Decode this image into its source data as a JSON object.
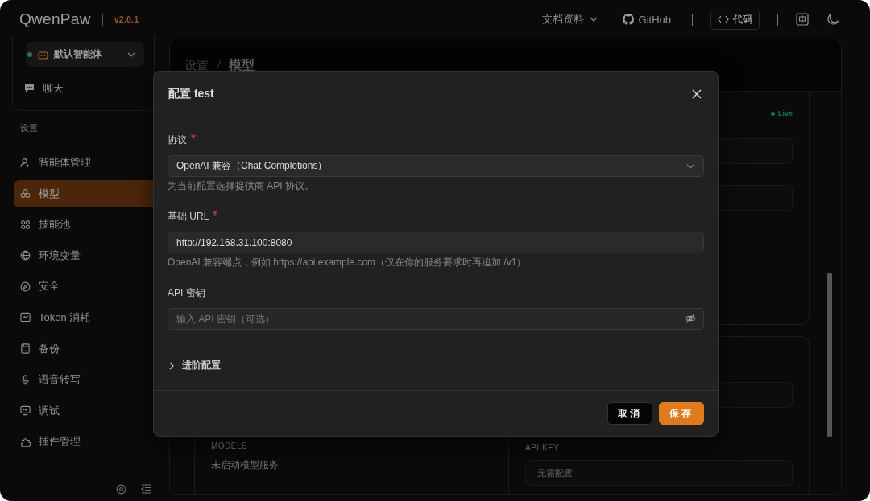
{
  "header": {
    "brand": "QwenPaw",
    "version": "v2.0.1",
    "nav": [
      {
        "label": "文档资料",
        "kind": "dropdown"
      },
      {
        "label": "GitHub",
        "kind": "github"
      },
      {
        "label": "代码",
        "kind": "code"
      }
    ]
  },
  "sidebar": {
    "agent": {
      "name": "默认智能体",
      "online": true
    },
    "chat": "聊天",
    "section": "设置",
    "items": [
      {
        "label": "智能体管理",
        "selected": false
      },
      {
        "label": "模型",
        "selected": true
      },
      {
        "label": "技能池",
        "selected": false
      },
      {
        "label": "环境变量",
        "selected": false
      },
      {
        "label": "安全",
        "selected": false
      },
      {
        "label": "Token 消耗",
        "selected": false
      },
      {
        "label": "备份",
        "selected": false
      },
      {
        "label": "语音转写",
        "selected": false
      },
      {
        "label": "调试",
        "selected": false
      },
      {
        "label": "插件管理",
        "selected": false
      }
    ]
  },
  "page": {
    "breadcrumb": [
      "设置",
      "模型"
    ],
    "status": "Live",
    "cards": [
      {
        "label": "MODELS",
        "value": "未启动模型服务",
        "kind": "text"
      },
      {
        "label": "API KEY",
        "value": "无需配置",
        "kind": "field"
      }
    ]
  },
  "dialog": {
    "title": "配置 test",
    "fields": [
      {
        "label": "协议",
        "required": true,
        "kind": "select",
        "value": "OpenAI 兼容（Chat Completions）",
        "help": "为当前配置选择提供商 API 协议。"
      },
      {
        "label": "基础 URL",
        "required": true,
        "kind": "text",
        "value": "http://192.168.31.100:8080",
        "help": "OpenAI 兼容端点，例如 https://api.example.com（仅在你的服务要求时再追加 /v1）"
      },
      {
        "label": "API 密钥",
        "required": false,
        "kind": "password",
        "placeholder": "输入 API 密钥（可选）"
      }
    ],
    "advanced": {
      "label": "进阶配置",
      "expanded": false
    },
    "buttons": [
      {
        "label": "取消",
        "kind": "secondary"
      },
      {
        "label": "保存",
        "kind": "primary"
      }
    ]
  }
}
